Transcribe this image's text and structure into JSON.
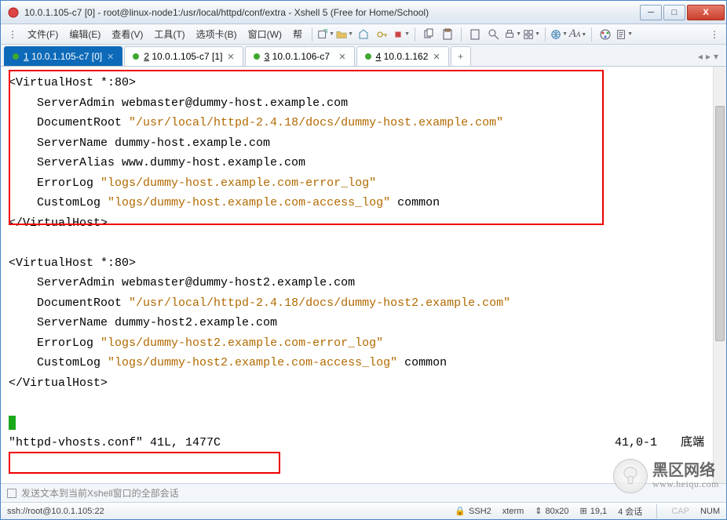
{
  "titlebar": {
    "text": "10.0.1.105-c7 [0] - root@linux-node1:/usr/local/httpd/conf/extra - Xshell 5 (Free for Home/School)"
  },
  "menus": {
    "file": "文件(F)",
    "edit": "编辑(E)",
    "view": "查看(V)",
    "tools": "工具(T)",
    "options": "选项卡(B)",
    "window": "窗口(W)",
    "help": "帮"
  },
  "tabs": [
    {
      "label_pre": "1",
      "label": " 10.0.1.105-c7 [0]",
      "active": true
    },
    {
      "label_pre": "2",
      "label": " 10.0.1.105-c7 [1]",
      "active": false
    },
    {
      "label_pre": "3",
      "label": " 10.0.1.106-c7",
      "active": false
    },
    {
      "label_pre": "4",
      "label": " 10.0.1.162",
      "active": false
    }
  ],
  "term": {
    "block1": {
      "l1": "<VirtualHost *:80>",
      "l2": "    ServerAdmin webmaster@dummy-host.example.com",
      "l3a": "    DocumentRoot ",
      "l3b": "\"/usr/local/httpd-2.4.18/docs/dummy-host.example.com\"",
      "l4": "    ServerName dummy-host.example.com",
      "l5": "    ServerAlias www.dummy-host.example.com",
      "l6a": "    ErrorLog ",
      "l6b": "\"logs/dummy-host.example.com-error_log\"",
      "l7a": "    CustomLog ",
      "l7b": "\"logs/dummy-host.example.com-access_log\"",
      "l7c": " common",
      "l8": "</VirtualHost>"
    },
    "block2": {
      "l1": "<VirtualHost *:80>",
      "l2": "    ServerAdmin webmaster@dummy-host2.example.com",
      "l3a": "    DocumentRoot ",
      "l3b": "\"/usr/local/httpd-2.4.18/docs/dummy-host2.example.com\"",
      "l4": "    ServerName dummy-host2.example.com",
      "l5a": "    ErrorLog ",
      "l5b": "\"logs/dummy-host2.example.com-error_log\"",
      "l6a": "    CustomLog ",
      "l6b": "\"logs/dummy-host2.example.com-access_log\"",
      "l6c": " common",
      "l7": "</VirtualHost>"
    },
    "status_file": "\"httpd-vhosts.conf\" 41L, 1477C",
    "status_pos": "41,0-1",
    "status_end": "底端"
  },
  "footer": {
    "hint": "发送文本到当前Xshell窗口的全部会话",
    "conn": "ssh://root@10.0.1.105:22",
    "proto": "SSH2",
    "termtype": "xterm",
    "size": "80x20",
    "cursor": "19,1",
    "sessions": "4 会话",
    "caps": "CAP",
    "num": "NUM"
  },
  "watermark": {
    "top": "黑区网络",
    "bottom": "www.heiqu.com"
  }
}
